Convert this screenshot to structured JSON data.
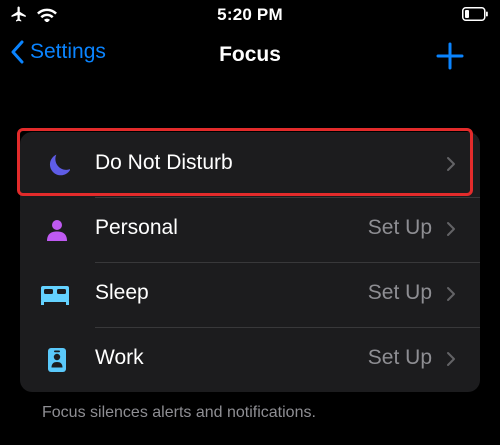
{
  "status_bar": {
    "time": "5:20 PM",
    "icons": [
      "airplane-icon",
      "wifi-icon",
      "battery-icon"
    ]
  },
  "nav": {
    "back_label": "Settings",
    "title": "Focus",
    "add_icon": "plus-icon"
  },
  "focus_modes": [
    {
      "label": "Do Not Disturb",
      "value": "",
      "icon": "moon-icon",
      "color": "#5e5ce6"
    },
    {
      "label": "Personal",
      "value": "Set Up",
      "icon": "person-icon",
      "color": "#bf5af2"
    },
    {
      "label": "Sleep",
      "value": "Set Up",
      "icon": "bed-icon",
      "color": "#64d2ff"
    },
    {
      "label": "Work",
      "value": "Set Up",
      "icon": "id-badge-icon",
      "color": "#5ac8fa"
    }
  ],
  "footer": {
    "note": "Focus silences alerts and notifications."
  },
  "colors": {
    "accent": "#0a84ff",
    "background": "#000000",
    "group_background": "#1c1c1e",
    "secondary_text": "#8e8e93",
    "highlight": "#e32b2b"
  }
}
